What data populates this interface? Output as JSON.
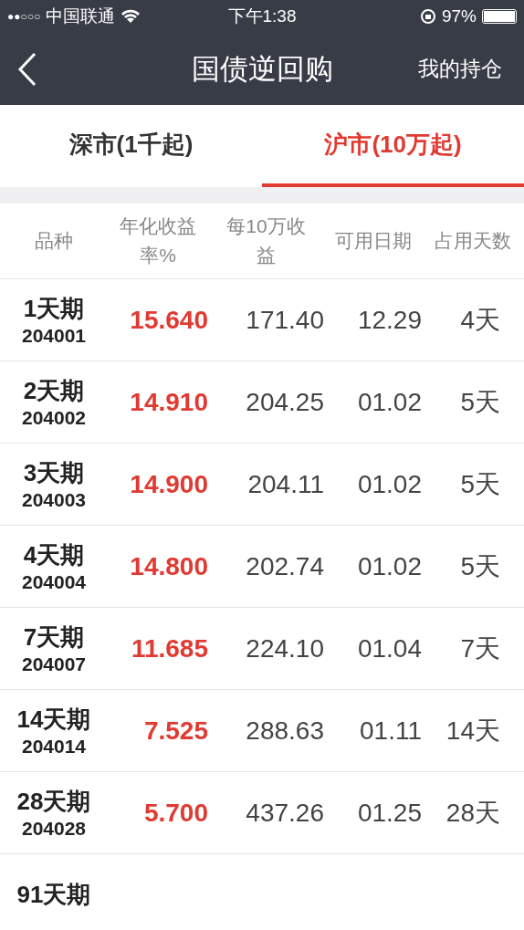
{
  "status_bar": {
    "signal": "●●○○○",
    "carrier": "中国联通",
    "time": "下午1:38",
    "battery": "97%"
  },
  "nav": {
    "title": "国债逆回购",
    "action": "我的持仓"
  },
  "tabs": [
    {
      "label": "深市(1千起)",
      "selected": false
    },
    {
      "label": "沪市(10万起)",
      "selected": true
    }
  ],
  "table": {
    "columns": [
      "品种",
      "年化收益率%",
      "每10万收益",
      "可用日期",
      "占用天数"
    ],
    "rows": [
      {
        "name": "1天期",
        "code": "204001",
        "rate": "15.640",
        "income": "171.40",
        "date": "12.29",
        "days": "4天"
      },
      {
        "name": "2天期",
        "code": "204002",
        "rate": "14.910",
        "income": "204.25",
        "date": "01.02",
        "days": "5天"
      },
      {
        "name": "3天期",
        "code": "204003",
        "rate": "14.900",
        "income": "204.11",
        "date": "01.02",
        "days": "5天"
      },
      {
        "name": "4天期",
        "code": "204004",
        "rate": "14.800",
        "income": "202.74",
        "date": "01.02",
        "days": "5天"
      },
      {
        "name": "7天期",
        "code": "204007",
        "rate": "11.685",
        "income": "224.10",
        "date": "01.04",
        "days": "7天"
      },
      {
        "name": "14天期",
        "code": "204014",
        "rate": "7.525",
        "income": "288.63",
        "date": "01.11",
        "days": "14天"
      },
      {
        "name": "28天期",
        "code": "204028",
        "rate": "5.700",
        "income": "437.26",
        "date": "01.25",
        "days": "28天"
      },
      {
        "name": "91天期"
      }
    ]
  }
}
